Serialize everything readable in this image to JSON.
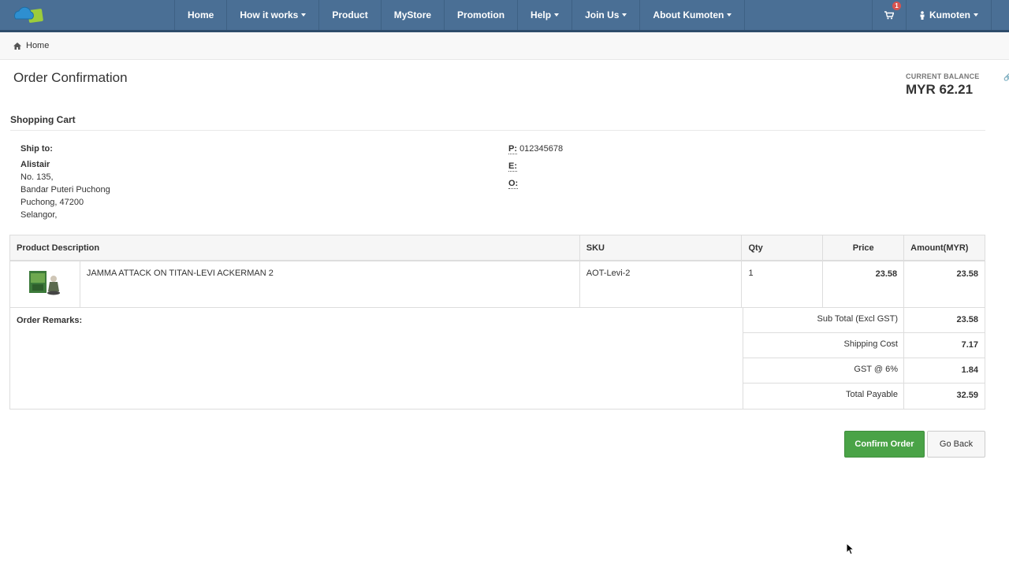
{
  "nav": {
    "items": [
      {
        "label": "Home",
        "dropdown": false
      },
      {
        "label": "How it works",
        "dropdown": true
      },
      {
        "label": "Product",
        "dropdown": false
      },
      {
        "label": "MyStore",
        "dropdown": false
      },
      {
        "label": "Promotion",
        "dropdown": false
      },
      {
        "label": "Help",
        "dropdown": true
      },
      {
        "label": "Join Us",
        "dropdown": true
      },
      {
        "label": "About Kumoten",
        "dropdown": true
      }
    ],
    "cart_count": "1",
    "user_label": "Kumoten"
  },
  "breadcrumb": {
    "home": "Home"
  },
  "page": {
    "title": "Order Confirmation",
    "balance_label": "CURRENT BALANCE",
    "balance_value": "MYR 62.21"
  },
  "cart": {
    "section_title": "Shopping Cart",
    "ship_to_label": "Ship to:",
    "name": "Alistair",
    "address_lines": [
      "No. 135,",
      "Bandar Puteri Puchong",
      "Puchong, 47200",
      "Selangor,"
    ],
    "contact": {
      "p_label": "P:",
      "p_value": "012345678",
      "e_label": "E:",
      "e_value": "",
      "o_label": "O:",
      "o_value": ""
    }
  },
  "table": {
    "headers": {
      "description": "Product Description",
      "sku": "SKU",
      "qty": "Qty",
      "price": "Price",
      "amount": "Amount(MYR)"
    },
    "rows": [
      {
        "description": "JAMMA ATTACK ON TITAN-LEVI ACKERMAN 2",
        "sku": "AOT-Levi-2",
        "qty": "1",
        "price": "23.58",
        "amount": "23.58"
      }
    ],
    "remarks_label": "Order Remarks:",
    "totals": [
      {
        "label": "Sub Total (Excl GST)",
        "value": "23.58"
      },
      {
        "label": "Shipping Cost",
        "value": "7.17"
      },
      {
        "label": "GST @ 6%",
        "value": "1.84"
      },
      {
        "label": "Total Payable",
        "value": "32.59"
      }
    ]
  },
  "actions": {
    "confirm_label": "Confirm Order",
    "back_label": "Go Back"
  },
  "colors": {
    "navbar": "#4a6f95",
    "confirm": "#4aa347"
  }
}
